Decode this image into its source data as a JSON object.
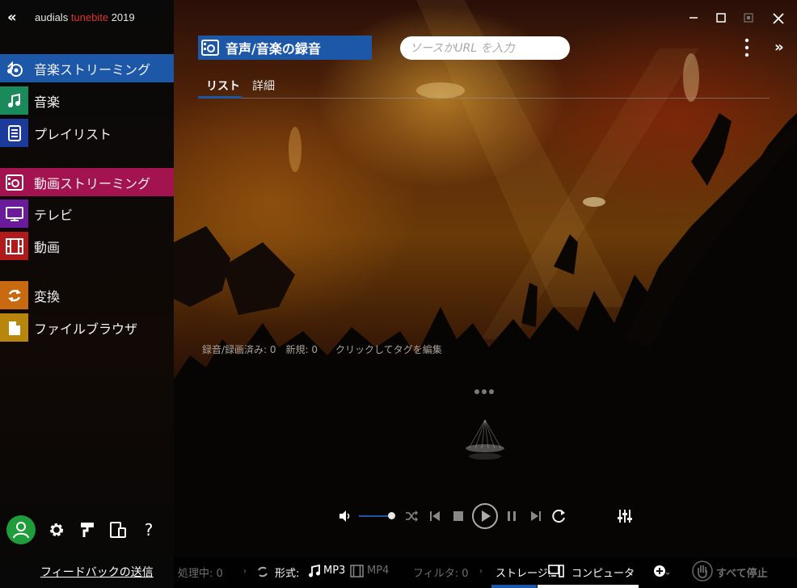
{
  "app": {
    "brand_prefix": "audials ",
    "brand_name": "tunebite",
    "brand_year": " 2019",
    "colors": {
      "accent": "#1c57a8",
      "video_accent": "#a3134f",
      "brand_red": "#e0322f"
    }
  },
  "sidebar": {
    "collapse_label": "«",
    "items": [
      {
        "label": "音楽ストリーミング",
        "icon": "music-streaming-icon",
        "color": "#1c57a8"
      },
      {
        "label": "音楽",
        "icon": "music-note-icon",
        "color": "#1a8a5a"
      },
      {
        "label": "プレイリスト",
        "icon": "playlist-icon",
        "color": "#1c3a9a"
      },
      {
        "label": "動画ストリーミング",
        "icon": "video-streaming-icon",
        "color": "#a3134f"
      },
      {
        "label": "テレビ",
        "icon": "tv-icon",
        "color": "#6a1a9a"
      },
      {
        "label": "動画",
        "icon": "film-icon",
        "color": "#b01a1a"
      },
      {
        "label": "変換",
        "icon": "convert-icon",
        "color": "#c86a10"
      },
      {
        "label": "ファイルブラウザ",
        "icon": "file-browser-icon",
        "color": "#b8860b"
      }
    ],
    "feedback": "フィードバックの送信",
    "help_label": "?"
  },
  "header": {
    "title": "音声/音楽の録音",
    "search_placeholder": "ソースかURL を入力",
    "expand_label": "»"
  },
  "tabs": [
    {
      "label": "リスト"
    },
    {
      "label": "詳細"
    }
  ],
  "stats": {
    "recorded": "録音/録画済み: 0",
    "new": "新規: 0",
    "edit_tags": "クリックしてタグを編集"
  },
  "player": {
    "volume_level": 0.9
  },
  "status_bar": {
    "processing": "処理中: 0",
    "format_label": "形式:",
    "mp3": "MP3",
    "mp4": "MP4",
    "filter": "フィルタ: 0",
    "storage": "ストレージ:",
    "computer": "コンピュータ",
    "stop_all": "すべて停止",
    "separator": "›"
  }
}
